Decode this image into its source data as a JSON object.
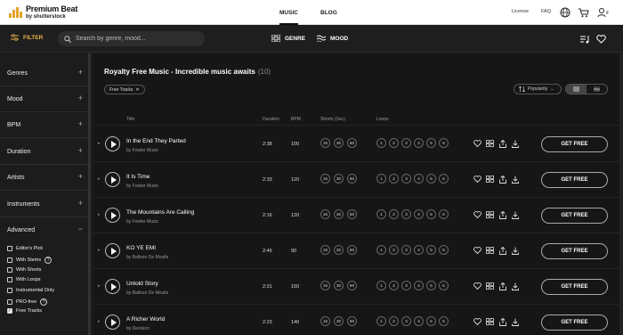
{
  "header": {
    "logo_main": "Premium Beat",
    "logo_sub": "by shutterstock",
    "nav": [
      "MUSIC",
      "BLOG"
    ],
    "license_label": "License",
    "faq_label": "FAQ"
  },
  "filterbar": {
    "filter_label": "FILTER",
    "search_placeholder": "Search by genre, mood...",
    "genre_label": "GENRE",
    "mood_label": "MOOD"
  },
  "sidebar": {
    "sections": [
      "Genres",
      "Mood",
      "BPM",
      "Duration",
      "Artists",
      "Instruments",
      "Advanced"
    ],
    "options": [
      {
        "label": "Editor's Pick",
        "checked": false,
        "info": false
      },
      {
        "label": "With Stems",
        "checked": false,
        "info": true
      },
      {
        "label": "With Shorts",
        "checked": false,
        "info": false
      },
      {
        "label": "With Loops",
        "checked": false,
        "info": false
      },
      {
        "label": "Instrumental Only",
        "checked": false,
        "info": false
      },
      {
        "label": "PRO-free",
        "checked": false,
        "info": true
      },
      {
        "label": "Free Tracks",
        "checked": true,
        "info": false
      }
    ]
  },
  "main": {
    "title": "Royalty Free Music - Incredible music awaits",
    "count": "(10)",
    "chip": "Free Tracks",
    "sort": "Popularity",
    "columns": {
      "title": "Title",
      "duration": "Duration",
      "bpm": "BPM",
      "shorts": "Shorts (Sec)",
      "loops": "Loops"
    },
    "get_free": "GET FREE",
    "tracks": [
      {
        "title": "In the End They Parted",
        "artist": "by Fowler Music",
        "duration": "2:38",
        "bpm": "100"
      },
      {
        "title": "It Is Time",
        "artist": "by Fowler Music",
        "duration": "2:33",
        "bpm": "120"
      },
      {
        "title": "The Mountains Are Calling",
        "artist": "by Fowler Music",
        "duration": "2:16",
        "bpm": "120"
      },
      {
        "title": "KO YE EMI",
        "artist": "by Balloon De Moulle",
        "duration": "2:46",
        "bpm": "90"
      },
      {
        "title": "Untold Story",
        "artist": "by Balloon De Moulle",
        "duration": "2:31",
        "bpm": "150"
      },
      {
        "title": "A Richer World",
        "artist": "by Devision",
        "duration": "2:23",
        "bpm": "140"
      }
    ],
    "shorts": [
      "15",
      "30",
      "60"
    ],
    "loops": [
      "1",
      "2",
      "3",
      "4",
      "5",
      "6"
    ]
  },
  "colors": {
    "accent": "#e8b04a",
    "background": "#161616"
  }
}
